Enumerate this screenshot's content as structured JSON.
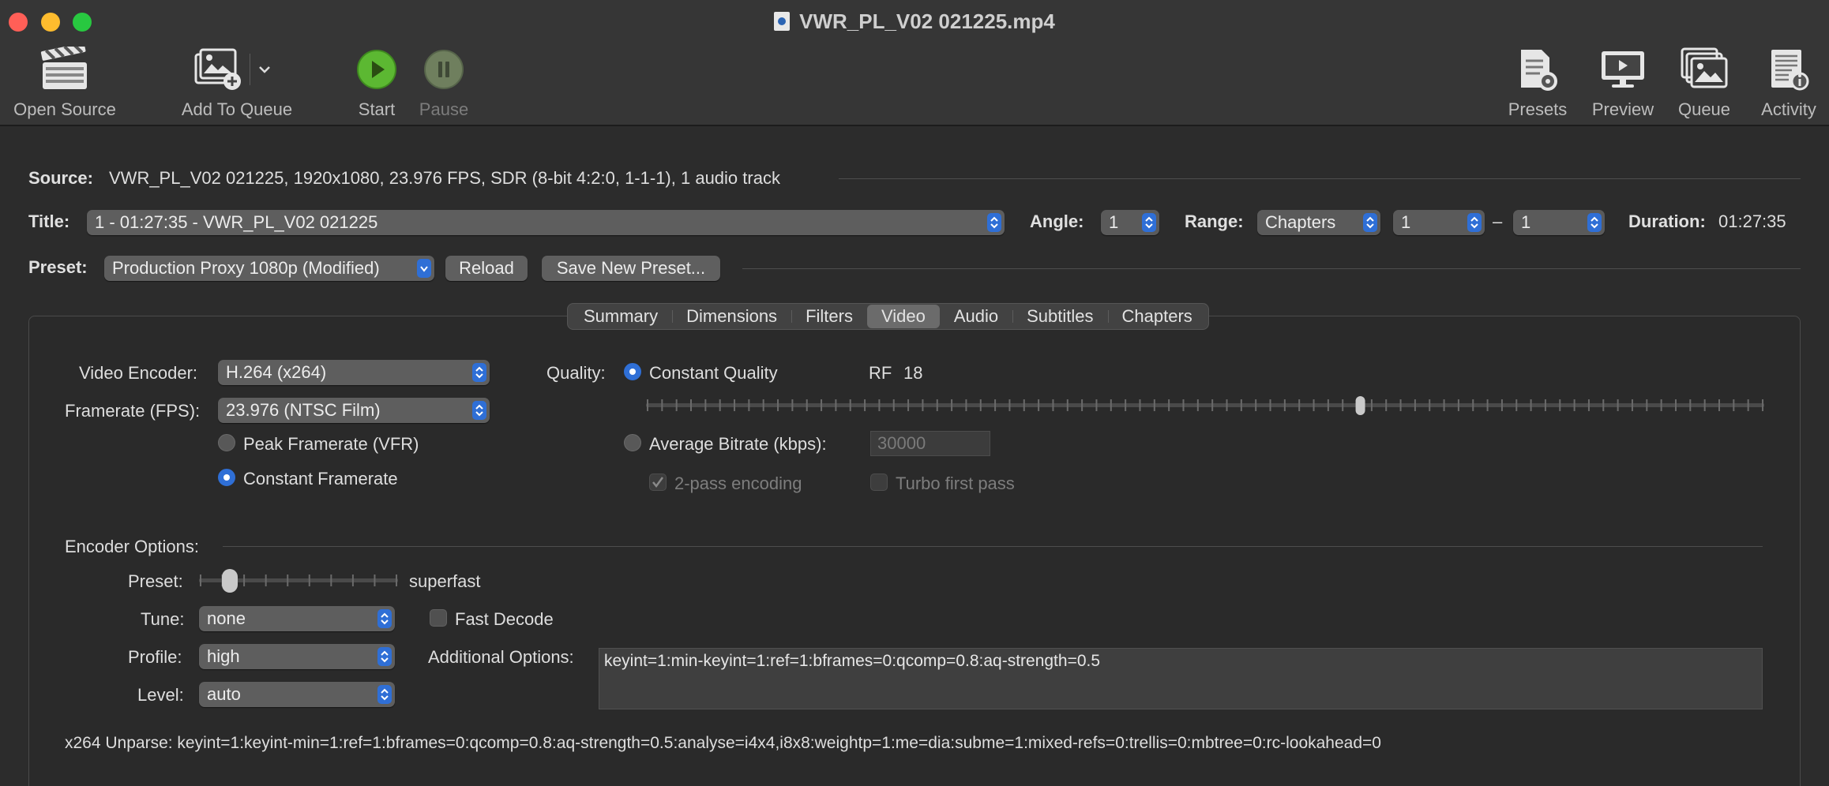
{
  "window": {
    "title": "VWR_PL_V02 021225.mp4"
  },
  "toolbar": {
    "open_source": "Open Source",
    "add_to_queue": "Add To Queue",
    "start": "Start",
    "pause": "Pause",
    "presets": "Presets",
    "preview": "Preview",
    "queue": "Queue",
    "activity": "Activity"
  },
  "source": {
    "label": "Source:",
    "value": "VWR_PL_V02 021225, 1920x1080, 23.976 FPS, SDR (8-bit 4:2:0, 1-1-1), 1 audio track"
  },
  "title_row": {
    "label": "Title:",
    "value": "1 - 01:27:35 - VWR_PL_V02 021225",
    "angle_label": "Angle:",
    "angle_value": "1",
    "range_label": "Range:",
    "range_type": "Chapters",
    "range_from": "1",
    "range_sep": "–",
    "range_to": "1",
    "duration_label": "Duration:",
    "duration_value": "01:27:35"
  },
  "preset_row": {
    "label": "Preset:",
    "value": "Production Proxy 1080p (Modified)",
    "reload": "Reload",
    "save_new": "Save New Preset..."
  },
  "tabs": [
    "Summary",
    "Dimensions",
    "Filters",
    "Video",
    "Audio",
    "Subtitles",
    "Chapters"
  ],
  "active_tab": "Video",
  "video": {
    "encoder_label": "Video Encoder:",
    "encoder_value": "H.264 (x264)",
    "framerate_label": "Framerate (FPS):",
    "framerate_value": "23.976 (NTSC Film)",
    "peak_framerate": "Peak Framerate (VFR)",
    "constant_framerate": "Constant Framerate",
    "framerate_mode": "constant",
    "quality_label": "Quality:",
    "constant_quality": "Constant Quality",
    "rf_label": "RF",
    "rf_value": "18",
    "quality_slider_fraction": 0.64,
    "average_bitrate": "Average Bitrate (kbps):",
    "bitrate_value": "30000",
    "two_pass": "2-pass encoding",
    "turbo_first_pass": "Turbo first pass"
  },
  "encoder_options": {
    "title": "Encoder Options:",
    "preset_label": "Preset:",
    "preset_value": "superfast",
    "preset_slider_fraction": 0.125,
    "tune_label": "Tune:",
    "tune_value": "none",
    "fast_decode": "Fast Decode",
    "profile_label": "Profile:",
    "profile_value": "high",
    "level_label": "Level:",
    "level_value": "auto",
    "additional_label": "Additional Options:",
    "additional_value": "keyint=1:min-keyint=1:ref=1:bframes=0:qcomp=0.8:aq-strength=0.5",
    "unparse": "x264 Unparse: keyint=1:keyint-min=1:ref=1:bframes=0:qcomp=0.8:aq-strength=0.5:analyse=i4x4,i8x8:weightp=1:me=dia:subme=1:mixed-refs=0:trellis=0:mbtree=0:rc-lookahead=0"
  },
  "colors": {
    "accent": "#2f6fd6",
    "start_green": "#5cb832",
    "background": "#2c2c2c"
  }
}
